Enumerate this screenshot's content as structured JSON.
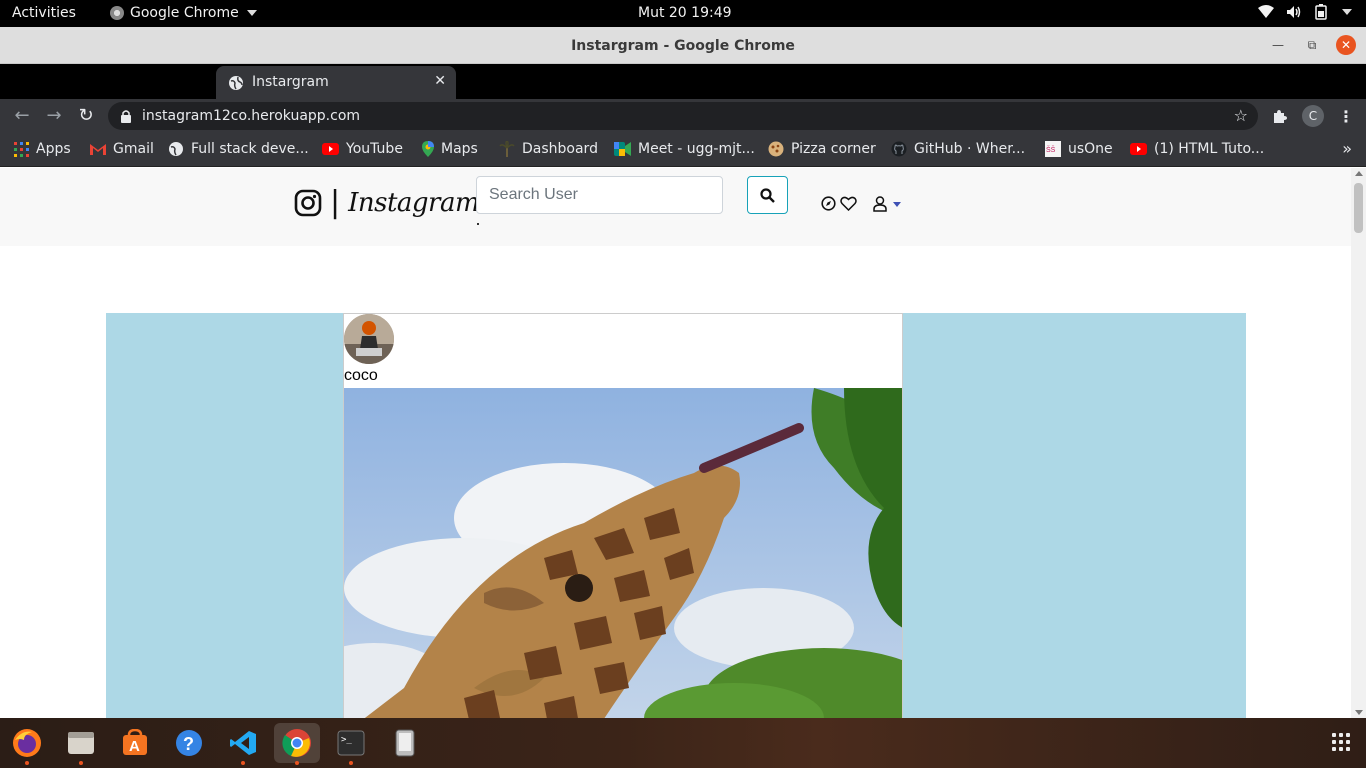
{
  "system_bar": {
    "activities": "Activities",
    "app_name": "Google Chrome",
    "clock": "Mut 20  19:49"
  },
  "window": {
    "title": "Instargram - Google Chrome"
  },
  "tab": {
    "title": "Instargram"
  },
  "omnibox": {
    "url": "instagram12co.herokuapp.com"
  },
  "profile": {
    "initial": "C"
  },
  "bookmarks": [
    {
      "label": "Apps",
      "icon": "apps-grid-icon",
      "color": "#ea4335"
    },
    {
      "label": "Gmail",
      "icon": "gmail-icon",
      "color": "#ea4335"
    },
    {
      "label": "Full stack deve...",
      "icon": "globe-icon",
      "color": "#e8eaed"
    },
    {
      "label": "YouTube",
      "icon": "youtube-icon",
      "color": "#ff0000"
    },
    {
      "label": "Maps",
      "icon": "maps-icon",
      "color": "#34a853"
    },
    {
      "label": "Dashboard",
      "icon": "palm-icon",
      "color": "#5a5a3a"
    },
    {
      "label": "Meet - ugg-mjt...",
      "icon": "meet-icon",
      "color": "#00897b"
    },
    {
      "label": "Pizza corner",
      "icon": "pizza-icon",
      "color": "#c8a26b"
    },
    {
      "label": "GitHub · Wher...",
      "icon": "github-icon",
      "color": "#1b1f23"
    },
    {
      "label": "usOne",
      "icon": "usone-icon",
      "color": "#f5f5f5"
    },
    {
      "label": "(1) HTML Tuto...",
      "icon": "youtube-icon",
      "color": "#ff0000"
    }
  ],
  "site": {
    "brand_separator": "|",
    "brand_name": "Instagram",
    "search_placeholder": "Search User",
    "accent_button_border": "#17a2b8",
    "feed_background": "#add8e6"
  },
  "post": {
    "username": "coco"
  },
  "dock": [
    {
      "name": "firefox-icon"
    },
    {
      "name": "files-icon"
    },
    {
      "name": "software-icon"
    },
    {
      "name": "help-icon"
    },
    {
      "name": "vscode-icon"
    },
    {
      "name": "chrome-icon"
    },
    {
      "name": "terminal-icon"
    },
    {
      "name": "device-icon"
    }
  ]
}
